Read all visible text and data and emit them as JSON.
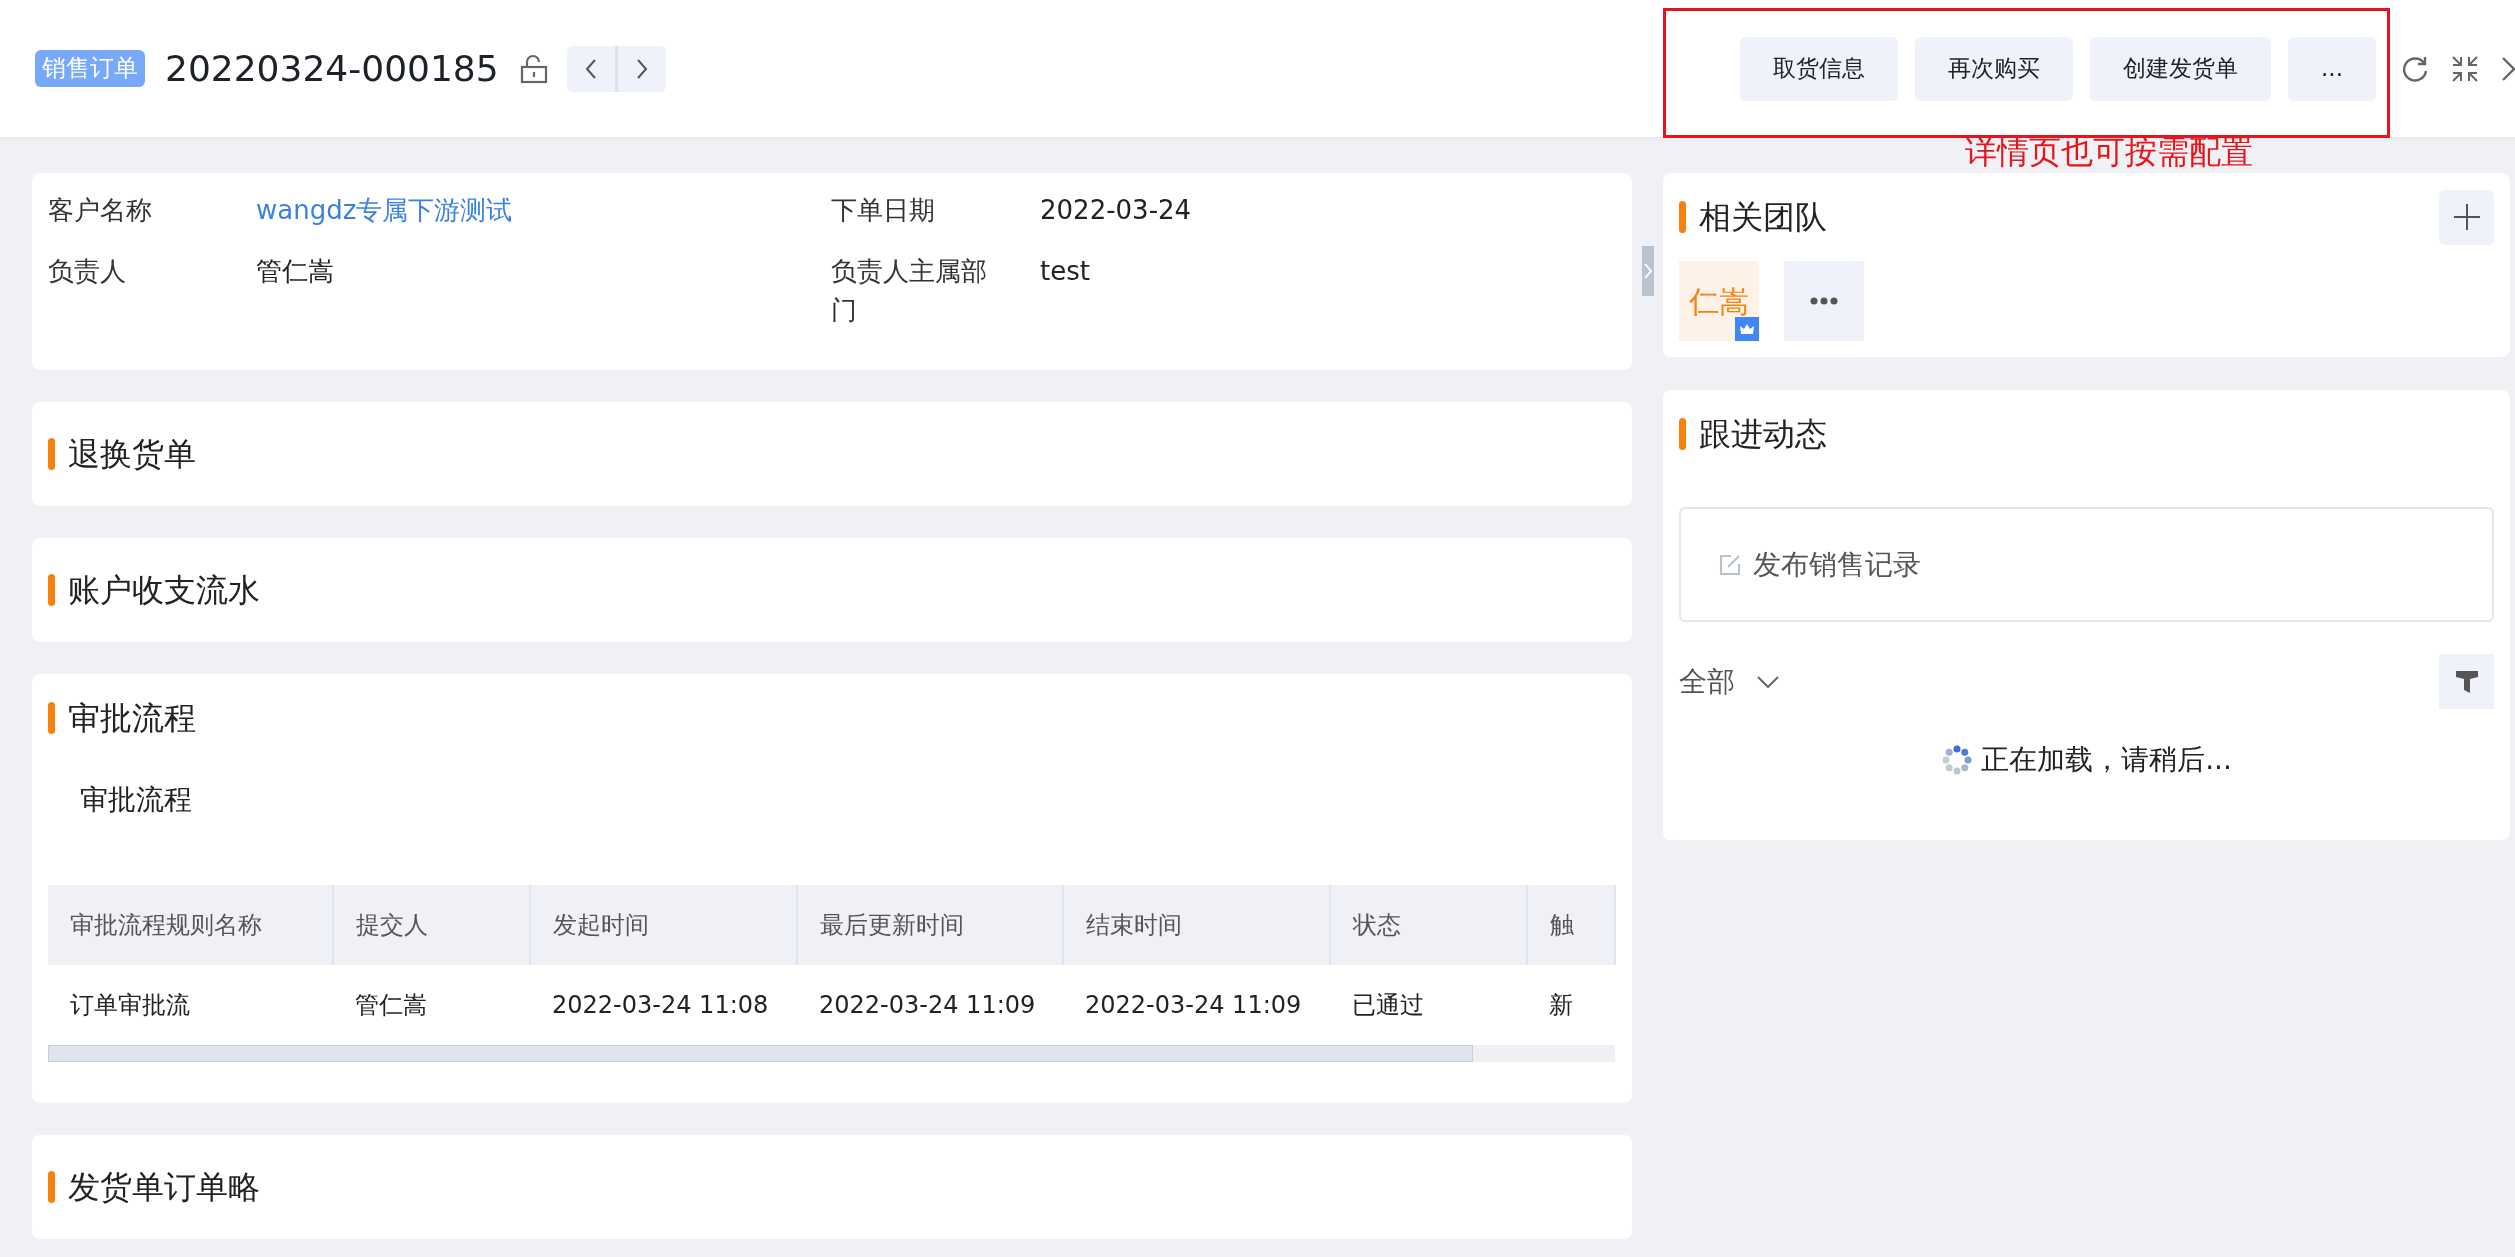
{
  "header": {
    "badge": "销售订单",
    "title": "20220324-000185",
    "actions": [
      "取货信息",
      "再次购买",
      "创建发货单",
      "..."
    ]
  },
  "annotation": "详情页也可按需配置",
  "info_fields": [
    {
      "label": "客户名称",
      "value": "wangdz专属下游测试",
      "link": true
    },
    {
      "label": "下单日期",
      "value": "2022-03-24",
      "link": false
    },
    {
      "label": "负责人",
      "value": "管仁嵩",
      "link": false
    },
    {
      "label": "负责人主属部门",
      "value": "test",
      "link": false
    }
  ],
  "sections": [
    {
      "title": "退换货单"
    },
    {
      "title": "账户收支流水"
    },
    {
      "title": "审批流程",
      "subtitle": "审批流程",
      "table": {
        "columns": [
          "审批流程规则名称",
          "提交人",
          "发起时间",
          "最后更新时间",
          "结束时间",
          "状态",
          "触"
        ],
        "rows": [
          [
            "订单审批流",
            "管仁嵩",
            "2022-03-24 11:08",
            "2022-03-24 11:09",
            "2022-03-24 11:09",
            "已通过",
            "新"
          ]
        ]
      }
    },
    {
      "title": "发货单订单略"
    }
  ],
  "team": {
    "title": "相关团队",
    "members": [
      {
        "name": "仁嵩",
        "owner": true
      }
    ]
  },
  "activity": {
    "title": "跟进动态",
    "compose_label": "发布销售记录",
    "filter": "全部",
    "loading": "正在加载，请稍后..."
  }
}
